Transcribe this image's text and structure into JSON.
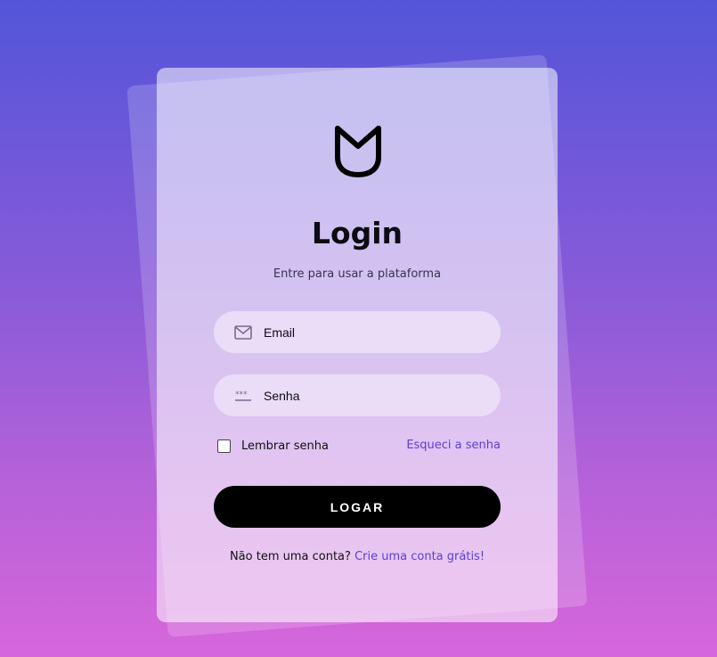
{
  "login": {
    "title": "Login",
    "subtitle": "Entre para usar a plataforma",
    "email_placeholder": "Email",
    "password_placeholder": "Senha",
    "remember_label": "Lembrar senha",
    "remember_checked": false,
    "forgot_link": "Esqueci a senha",
    "submit_label": "LOGAR",
    "signup_prompt": "Não tem uma conta?",
    "signup_link": "Crie uma conta grátis!"
  },
  "icons": {
    "logo": "shield-logo-icon",
    "email": "envelope-icon",
    "password": "password-dots-icon"
  },
  "colors": {
    "background_top": "#5355d9",
    "background_bottom": "#d766db",
    "link": "#5a3fd6",
    "button": "#000000"
  }
}
